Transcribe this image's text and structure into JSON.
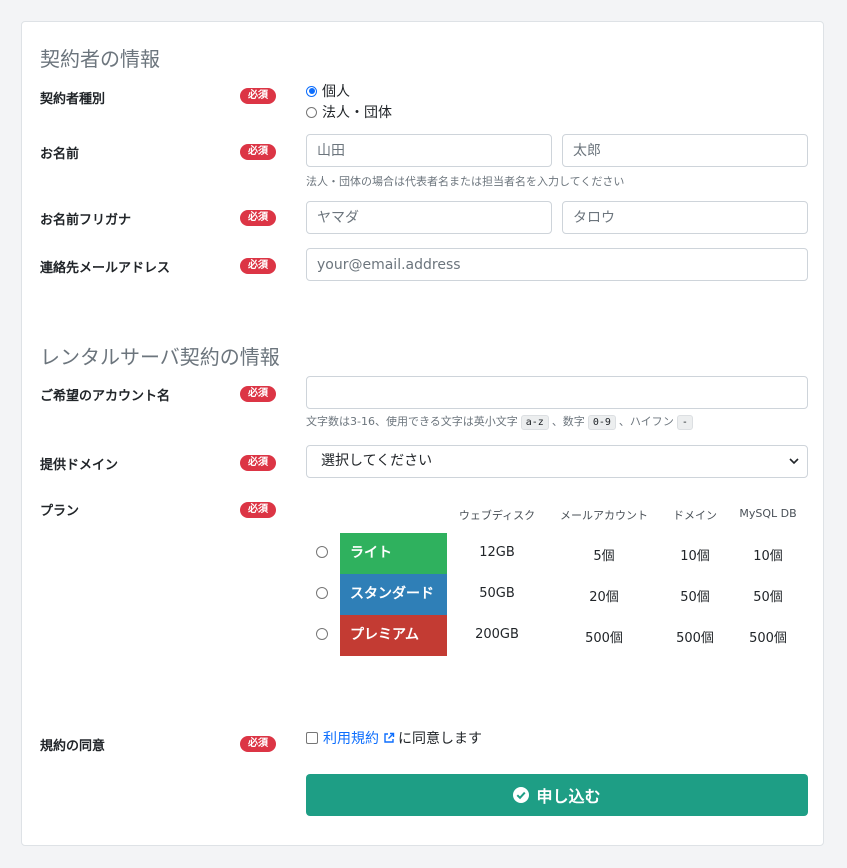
{
  "contractor": {
    "title": "契約者の情報",
    "required_label": "必須",
    "type": {
      "label": "契約者種別",
      "options": [
        "個人",
        "法人・団体"
      ],
      "selected": "個人"
    },
    "name": {
      "label": "お名前",
      "last_placeholder": "山田",
      "first_placeholder": "太郎",
      "help": "法人・団体の場合は代表者名または担当者名を入力してください"
    },
    "furigana": {
      "label": "お名前フリガナ",
      "last_placeholder": "ヤマダ",
      "first_placeholder": "タロウ"
    },
    "email": {
      "label": "連絡先メールアドレス",
      "placeholder": "your@email.address"
    }
  },
  "rental": {
    "title": "レンタルサーバ契約の情報",
    "account": {
      "label": "ご希望のアカウント名",
      "help_prefix": "文字数は3-16、使用できる文字は英小文字",
      "code1": "a-z",
      "help_mid1": "、数字",
      "code2": "0-9",
      "help_mid2": "、ハイフン",
      "code3": "-"
    },
    "domain": {
      "label": "提供ドメイン",
      "selected": "選択してください"
    },
    "plan": {
      "label": "プラン",
      "headers": [
        "ウェブディスク",
        "メールアカウント",
        "ドメイン",
        "MySQL DB"
      ],
      "rows": [
        {
          "name": "ライト",
          "color": "#2fb15e",
          "disk": "12GB",
          "mail": "5個",
          "domain": "10個",
          "db": "10個"
        },
        {
          "name": "スタンダード",
          "color": "#2f7fb7",
          "disk": "50GB",
          "mail": "20個",
          "domain": "50個",
          "db": "50個"
        },
        {
          "name": "プレミアム",
          "color": "#c33b33",
          "disk": "200GB",
          "mail": "500個",
          "domain": "500個",
          "db": "500個"
        }
      ]
    },
    "agreement": {
      "label": "規約の同意",
      "link_text": "利用規約",
      "suffix": "に同意します"
    }
  },
  "submit": {
    "label": "申し込む",
    "color": "#1e9e85"
  }
}
